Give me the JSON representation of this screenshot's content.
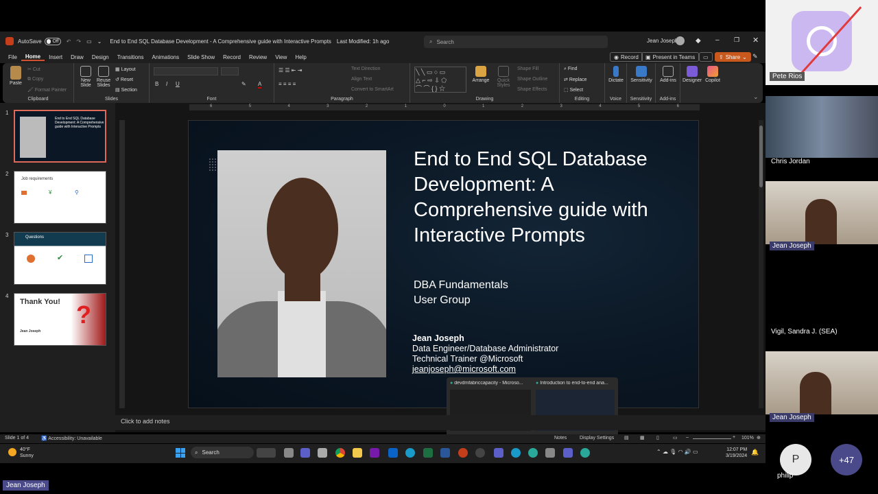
{
  "titlebar": {
    "autosave": "AutoSave",
    "toggle": "Off",
    "doc_title": "End to End SQL Database Development - A Comprehensive guide with Interactive Prompts",
    "modified": "Last Modified: 1h ago",
    "search_placeholder": "Search",
    "user": "Jean Joseph"
  },
  "menu": [
    "File",
    "Home",
    "Insert",
    "Draw",
    "Design",
    "Transitions",
    "Animations",
    "Slide Show",
    "Record",
    "Review",
    "View",
    "Help"
  ],
  "topbuttons": {
    "record": "Record",
    "present": "Present in Teams",
    "share": "Share"
  },
  "ribbon": {
    "clipboard": {
      "label": "Clipboard",
      "paste": "Paste",
      "cut": "Cut",
      "copy": "Copy",
      "painter": "Format Painter"
    },
    "slides": {
      "label": "Slides",
      "new": "New Slide",
      "reuse": "Reuse Slides",
      "layout": "Layout",
      "reset": "Reset",
      "section": "Section"
    },
    "font": {
      "label": "Font"
    },
    "paragraph": {
      "label": "Paragraph",
      "direction": "Text Direction",
      "align": "Align Text",
      "smartart": "Convert to SmartArt"
    },
    "drawing": {
      "label": "Drawing",
      "arrange": "Arrange",
      "quick": "Quick Styles",
      "fill": "Shape Fill",
      "outline": "Shape Outline",
      "effects": "Shape Effects"
    },
    "editing": {
      "label": "Editing",
      "find": "Find",
      "replace": "Replace",
      "select": "Select"
    },
    "voice": {
      "label": "Voice",
      "dictate": "Dictate"
    },
    "sensitivity": {
      "label": "Sensitivity",
      "btn": "Sensitivity"
    },
    "addins": {
      "label": "Add-ins",
      "btn": "Add-ins"
    },
    "designer": "Designer",
    "copilot": "Copilot"
  },
  "ruler": [
    "6",
    "5",
    "4",
    "3",
    "2",
    "1",
    "0",
    "1",
    "2",
    "3",
    "4",
    "5",
    "6"
  ],
  "thumbnails": [
    {
      "num": "1",
      "title": "End to End SQL Database Development: A Comprehensive guide with Interactive Prompts"
    },
    {
      "num": "2",
      "title": "Job requirements"
    },
    {
      "num": "3",
      "title": "Questions"
    },
    {
      "num": "4",
      "title": "Thank You!",
      "name": "Jean Joseph"
    }
  ],
  "slide": {
    "title": "End to End SQL Database Development: A Comprehensive guide with Interactive Prompts",
    "sub1": "DBA Fundamentals",
    "sub2": "User Group",
    "name": "Jean Joseph",
    "role": "Data Engineer/Database Administrator",
    "trainer": "Technical Trainer @Microsoft",
    "email": "jeanjoseph@microsoft.com"
  },
  "notes": "Click to add notes",
  "status": {
    "slide": "Slide 1 of 4",
    "access": "Accessibility: Unavailable",
    "notes": "Notes",
    "display": "Display Settings",
    "zoom": "101%"
  },
  "previews": [
    {
      "title": "devdmfabriccapacity - Microso..."
    },
    {
      "title": "Introduction to end-to-end ana..."
    }
  ],
  "taskbar": {
    "temp": "40°F",
    "weather": "Sunny",
    "search": "Search",
    "time": "12:07 PM",
    "date": "3/19/2024"
  },
  "participants": [
    {
      "name": "Pete Rios"
    },
    {
      "name": "Chris Jordan"
    },
    {
      "name": "Jean Joseph"
    },
    {
      "name": "Vigil, Sandra J. (SEA)"
    },
    {
      "name": "Jean Joseph"
    }
  ],
  "overflow": {
    "initial": "P",
    "name": "philip",
    "more": "+47"
  },
  "presenter_chip": "Jean Joseph",
  "colors": {
    "accent": "#d35230",
    "share": "#c8581c",
    "slide_bg": "#0b1724",
    "selected_thumb": "#e06a5a"
  }
}
